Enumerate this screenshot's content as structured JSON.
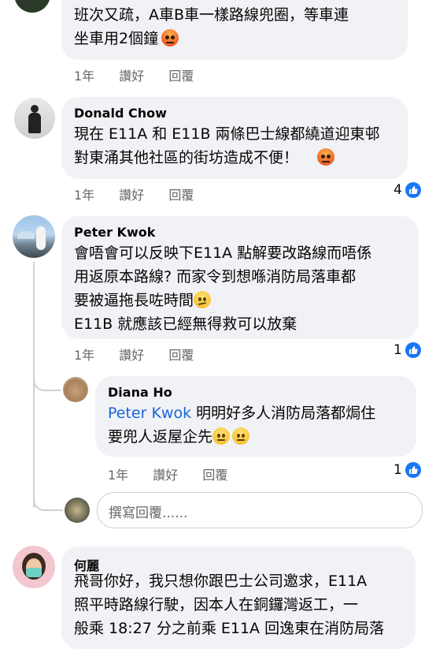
{
  "comments": [
    {
      "lines": [
        "班次又疏，A車B車一樣路線兜圈，等車連",
        "坐車用2個鐘"
      ],
      "emoji": "angry-emoji",
      "meta": {
        "time": "1年",
        "like": "讚好",
        "reply": "回覆"
      }
    },
    {
      "author": "Donald Chow",
      "lines": [
        "現在 E11A 和 E11B 兩條巴士線都繞道迎東邨",
        "對東涌其他社區的街坊造成不便！"
      ],
      "emoji": "angry-emoji",
      "meta": {
        "time": "1年",
        "like": "讚好",
        "reply": "回覆"
      },
      "likes": "4"
    },
    {
      "author": "Peter Kwok",
      "lines": [
        "會唔會可以反映下E11A 點解要改路線而唔係",
        "用返原本路線? 而家令到想喺消防局落車都",
        "要被逼拖長咗時間",
        "E11B 就應該已經無得救可以放棄"
      ],
      "emoji": "confused-emoji",
      "meta": {
        "time": "1年",
        "like": "讚好",
        "reply": "回覆"
      },
      "likes": "1"
    },
    {
      "author": "Diana Ho",
      "mention": "Peter Kwok",
      "lines": [
        " 明明好多人消防局落都焗住",
        "要兜人返屋企先"
      ],
      "emoji": "expressionless-emoji",
      "meta": {
        "time": "1年",
        "like": "讚好",
        "reply": "回覆"
      },
      "likes": "1"
    },
    {
      "author": "何麗",
      "lines": [
        "飛哥你好，我只想你跟巴士公司邀求，E11A",
        "照平時路線行駛，因本人在銅鑼灣返工，一",
        "般乘 18:27 分之前乘 E11A 回逸東在消防局落"
      ]
    }
  ],
  "reply_input": {
    "placeholder": "撰寫回覆......"
  }
}
